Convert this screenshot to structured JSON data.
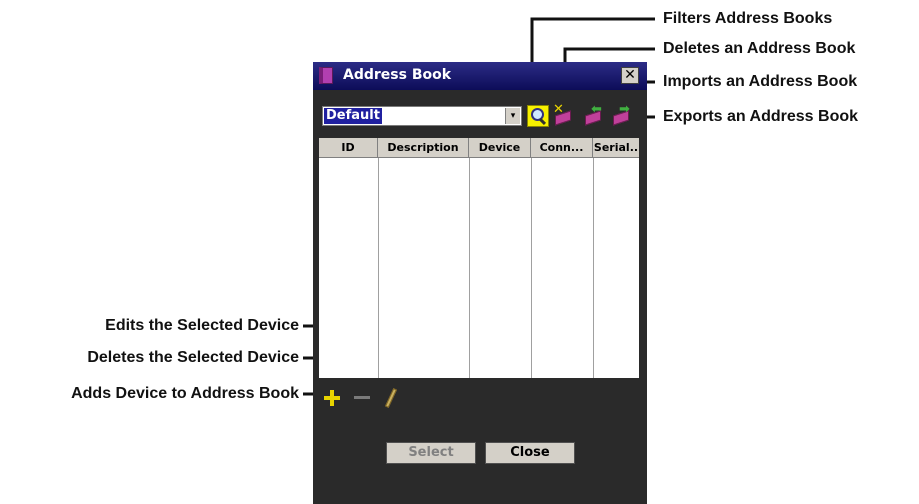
{
  "window": {
    "title": "Address Book",
    "close_glyph": "✕",
    "icon": "address-book-icon"
  },
  "combo": {
    "value": "Default",
    "arrow_glyph": "▾"
  },
  "toolbar": {
    "filter_icon": "magnifier-icon",
    "delete_icon": "book-delete-icon",
    "import_icon": "book-import-icon",
    "export_icon": "book-export-icon",
    "delete_marker": "✕",
    "import_marker": "⬅",
    "export_marker": "➡"
  },
  "table": {
    "columns": [
      "ID",
      "Description",
      "Device",
      "Conn...",
      "Serial.."
    ],
    "rows": []
  },
  "bottom_toolbar": {
    "add_icon": "plus-icon",
    "remove_icon": "minus-icon",
    "edit_icon": "pencil-icon"
  },
  "buttons": {
    "select_label": "Select",
    "close_label": "Close",
    "select_enabled": false
  },
  "annotations": {
    "filter": "Filters Address Books",
    "delete_book": "Deletes an Address Book",
    "import_book": "Imports an Address Book",
    "export_book": "Exports an Address Book",
    "edit_device": "Edits the Selected Device",
    "delete_device": "Deletes the Selected Device",
    "add_device": "Adds Device to Address Book"
  },
  "colors": {
    "title_bar": "#0c0c58",
    "window_body": "#2a2a2a",
    "selection": "#2020a0",
    "accent_yellow": "#f6f000",
    "book_pink": "#c0409a"
  }
}
